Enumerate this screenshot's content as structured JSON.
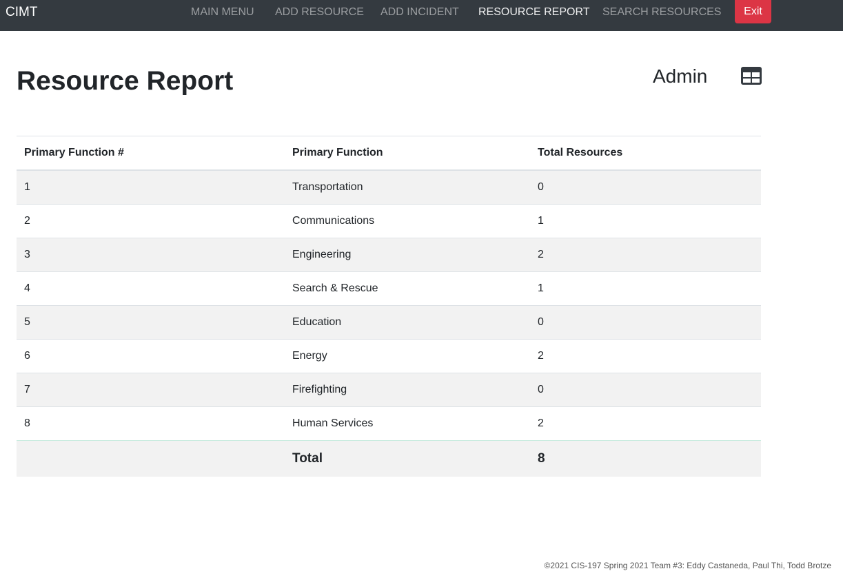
{
  "navbar": {
    "brand": "CIMT",
    "links": [
      {
        "label": "MAIN MENU",
        "active": false
      },
      {
        "label": "ADD RESOURCE",
        "active": false
      },
      {
        "label": "ADD INCIDENT",
        "active": false
      },
      {
        "label": "RESOURCE REPORT",
        "active": true
      },
      {
        "label": "SEARCH RESOURCES",
        "active": false
      }
    ],
    "exit_label": "Exit"
  },
  "page": {
    "title": "Resource Report",
    "user": "Admin",
    "view_icon": "table-icon"
  },
  "table": {
    "headers": [
      "Primary Function #",
      "Primary Function",
      "Total Resources"
    ],
    "rows": [
      {
        "num": "1",
        "function": "Transportation",
        "total": "0"
      },
      {
        "num": "2",
        "function": "Communications",
        "total": "1"
      },
      {
        "num": "3",
        "function": "Engineering",
        "total": "2"
      },
      {
        "num": "4",
        "function": "Search & Rescue",
        "total": "1"
      },
      {
        "num": "5",
        "function": "Education",
        "total": "0"
      },
      {
        "num": "6",
        "function": "Energy",
        "total": "2"
      },
      {
        "num": "7",
        "function": "Firefighting",
        "total": "0"
      },
      {
        "num": "8",
        "function": "Human Services",
        "total": "2"
      }
    ],
    "total_label": "Total",
    "total_value": "8"
  },
  "footer": {
    "text": "©2021 CIS-197 Spring 2021 Team #3: Eddy Castaneda, Paul Thi, Todd Brotze"
  },
  "colors": {
    "navbar_bg": "#343a40",
    "exit_bg": "#dc3545",
    "total_row_bg": "#d9f3ea",
    "striped_row_bg": "#f2f2f2"
  }
}
